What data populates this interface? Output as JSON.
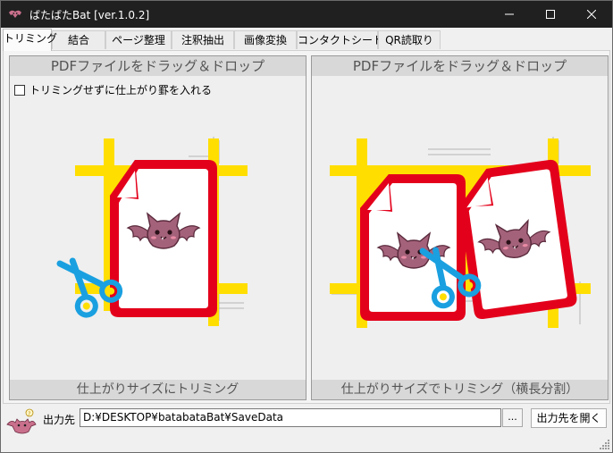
{
  "window": {
    "title": "ばたばたBat [ver.1.0.2]"
  },
  "tabs": [
    {
      "label": "トリミング",
      "active": true
    },
    {
      "label": "結合",
      "active": false
    },
    {
      "label": "ページ整理",
      "active": false
    },
    {
      "label": "注釈抽出",
      "active": false
    },
    {
      "label": "画像変換",
      "active": false
    },
    {
      "label": "コンタクトシート",
      "active": false
    },
    {
      "label": "QR読取り",
      "active": false
    }
  ],
  "left_panel": {
    "drop_header": "PDFファイルをドラッグ＆ドロップ",
    "checkbox_label": "トリミングせずに仕上がり罫を入れる",
    "checkbox_checked": false,
    "footer": "仕上がりサイズにトリミング"
  },
  "right_panel": {
    "drop_header": "PDFファイルをドラッグ＆ドロップ",
    "footer": "仕上がりサイズでトリミング（横長分割）"
  },
  "output": {
    "label": "出力先",
    "path": "D:¥DESKTOP¥batabataBat¥SaveData",
    "browse_label": "...",
    "open_label": "出力先を開く"
  },
  "colors": {
    "titlebar": "#202020",
    "crop_yellow": "#ffde00",
    "page_red": "#e3001b",
    "scissors_blue": "#1aa0e0",
    "bat_purple": "#a4627a"
  },
  "icons": {
    "app": "bat-icon",
    "minimize": "minimize-icon",
    "maximize": "maximize-icon",
    "close": "close-icon",
    "scissors": "scissors-icon",
    "document": "document-icon",
    "mascot": "bat-mascot-icon"
  }
}
